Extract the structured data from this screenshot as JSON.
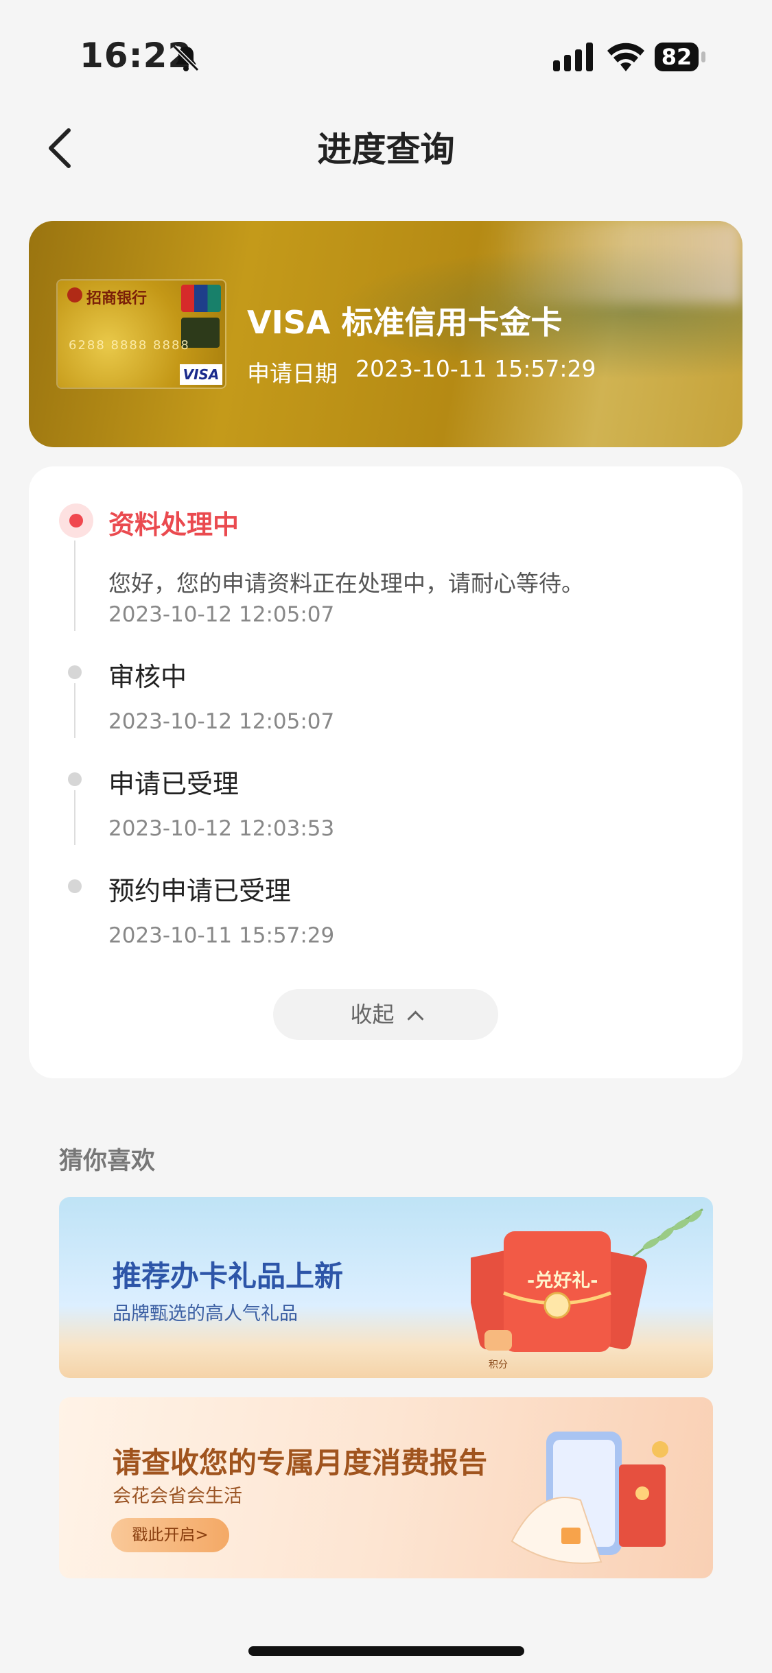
{
  "status_bar": {
    "time": "16:22",
    "battery": "82"
  },
  "nav": {
    "title": "进度查询"
  },
  "card": {
    "name": "VISA 标准信用卡金卡",
    "date_label": "申请日期",
    "date_value": "2023-10-11 15:57:29",
    "bank_text": "招商银行",
    "brand_text": "VISA",
    "number_text": "6288 8888 8888"
  },
  "progress": {
    "steps": [
      {
        "title": "资料处理中",
        "desc": "您好，您的申请资料正在处理中，请耐心等待。",
        "time": "2023-10-12 12:05:07"
      },
      {
        "title": "审核中",
        "time": "2023-10-12 12:05:07"
      },
      {
        "title": "申请已受理",
        "time": "2023-10-12 12:03:53"
      },
      {
        "title": "预约申请已受理",
        "time": "2023-10-11 15:57:29"
      }
    ],
    "collapse_label": "收起"
  },
  "recommend": {
    "title": "猜你喜欢",
    "banners": [
      {
        "title": "推荐办卡礼品上新",
        "subtitle": "品牌甄选的高人气礼品",
        "badge": "-兑好礼-",
        "tag": "积分"
      },
      {
        "title": "请查收您的专属月度消费报告",
        "subtitle": "会花会省会生活",
        "button": "戳此开启>"
      }
    ]
  },
  "colors": {
    "accent_red": "#ea4a4f",
    "gold": "#c49a1a",
    "bg": "#f5f5f5"
  }
}
